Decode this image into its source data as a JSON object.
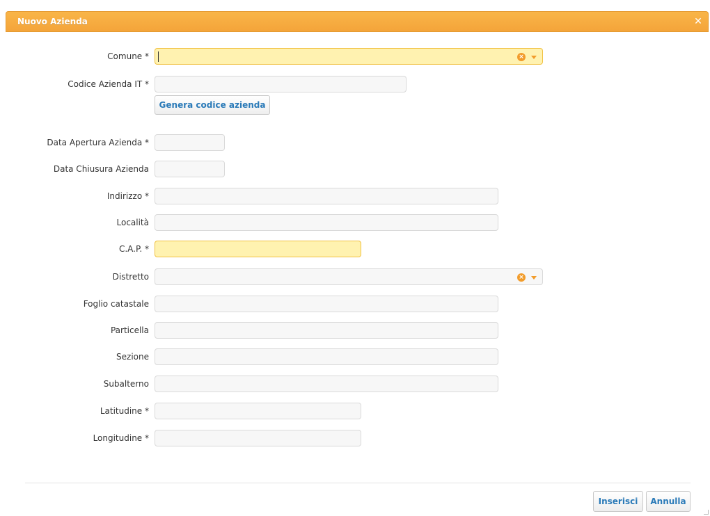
{
  "window": {
    "title": "Nuovo Azienda",
    "close_icon": "close-icon"
  },
  "form": {
    "fields": [
      {
        "key": "comune",
        "label": "Comune *",
        "value": "",
        "type": "combo"
      },
      {
        "key": "codice_azienda",
        "label": "Codice Azienda IT *",
        "value": ""
      },
      {
        "key": "data_apertura",
        "label": "Data Apertura Azienda *",
        "value": ""
      },
      {
        "key": "data_chiusura",
        "label": "Data Chiusura Azienda",
        "value": ""
      },
      {
        "key": "indirizzo",
        "label": "Indirizzo *",
        "value": ""
      },
      {
        "key": "localita",
        "label": "Località",
        "value": ""
      },
      {
        "key": "cap",
        "label": "C.A.P. *",
        "value": ""
      },
      {
        "key": "distretto",
        "label": "Distretto",
        "value": "",
        "type": "combo"
      },
      {
        "key": "foglio_catastale",
        "label": "Foglio catastale",
        "value": ""
      },
      {
        "key": "particella",
        "label": "Particella",
        "value": ""
      },
      {
        "key": "sezione",
        "label": "Sezione",
        "value": ""
      },
      {
        "key": "subalterno",
        "label": "Subalterno",
        "value": ""
      },
      {
        "key": "latitudine",
        "label": "Latitudine *",
        "value": ""
      },
      {
        "key": "longitudine",
        "label": "Longitudine *",
        "value": ""
      }
    ],
    "generate_code_label": "Genera codice azienda"
  },
  "footer": {
    "insert_label": "Inserisci",
    "cancel_label": "Annulla"
  },
  "colors": {
    "titlebar": "#f4a43a",
    "required_highlight": "#fff2b0",
    "button_text": "#2a7ab8",
    "combo_icon": "#f29c2b"
  }
}
